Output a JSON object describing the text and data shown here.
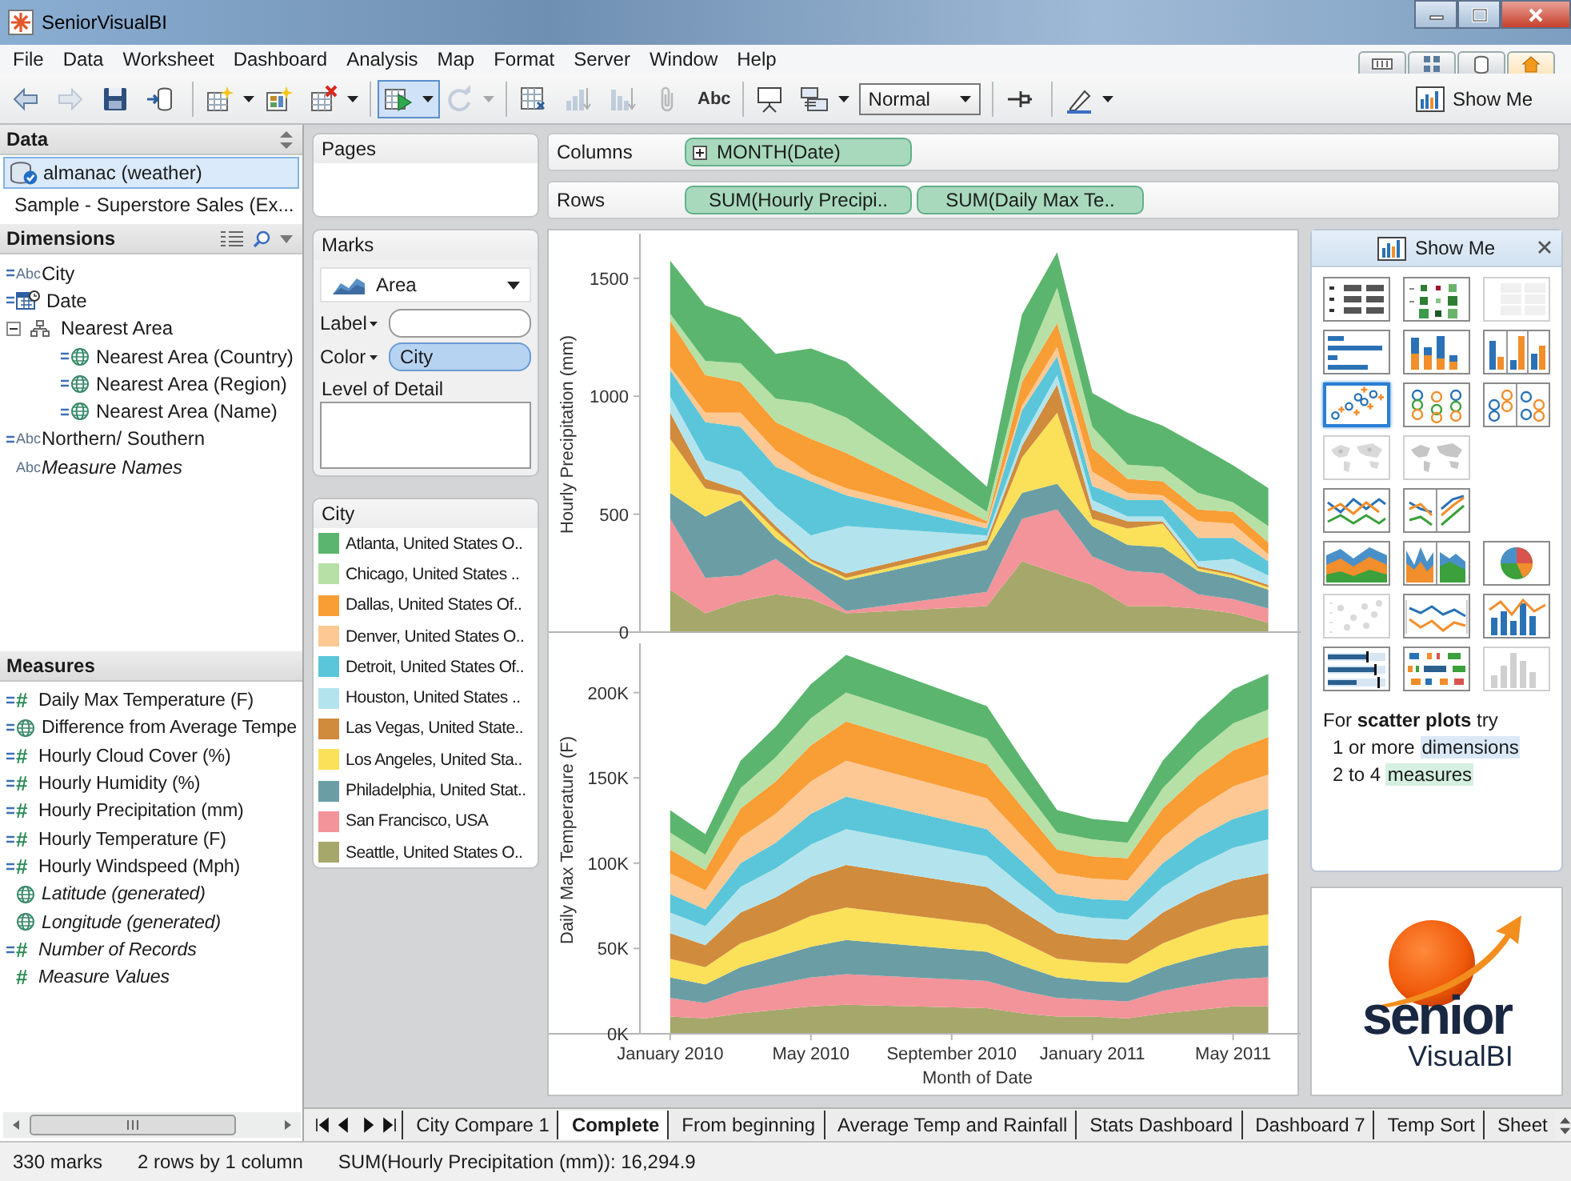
{
  "window": {
    "title": "SeniorVisualBI"
  },
  "menu": [
    "File",
    "Data",
    "Worksheet",
    "Dashboard",
    "Analysis",
    "Map",
    "Format",
    "Server",
    "Window",
    "Help"
  ],
  "view_tabs": [
    {
      "kind": "filmstrip",
      "selected": false
    },
    {
      "kind": "sorter",
      "selected": false
    },
    {
      "kind": "data",
      "selected": false
    },
    {
      "kind": "home",
      "selected": true
    }
  ],
  "toolbar": {
    "items": [
      {
        "kind": "back",
        "disabled": false,
        "pressed": false,
        "dropdown": false
      },
      {
        "kind": "forward",
        "disabled": true,
        "pressed": false,
        "dropdown": false
      },
      {
        "kind": "save",
        "disabled": false,
        "pressed": false,
        "dropdown": false
      },
      {
        "kind": "connect",
        "disabled": false,
        "pressed": false,
        "dropdown": false
      },
      {
        "kind": "separator"
      },
      {
        "kind": "new-sheet",
        "disabled": false,
        "pressed": false,
        "dropdown": true
      },
      {
        "kind": "new-dashboard",
        "disabled": false,
        "pressed": false,
        "dropdown": false
      },
      {
        "kind": "clear",
        "disabled": false,
        "pressed": false,
        "dropdown": true
      },
      {
        "kind": "separator"
      },
      {
        "kind": "auto-update",
        "disabled": false,
        "pressed": true,
        "dropdown": true
      },
      {
        "kind": "refresh",
        "disabled": true,
        "pressed": false,
        "dropdown": true
      },
      {
        "kind": "separator"
      },
      {
        "kind": "swap",
        "disabled": false,
        "pressed": false,
        "dropdown": false
      },
      {
        "kind": "sort-asc",
        "disabled": true,
        "pressed": false,
        "dropdown": false
      },
      {
        "kind": "sort-desc",
        "disabled": true,
        "pressed": false,
        "dropdown": false
      },
      {
        "kind": "attach",
        "disabled": true,
        "pressed": false,
        "dropdown": false
      },
      {
        "kind": "labels",
        "text": "Abc",
        "disabled": false,
        "pressed": false,
        "dropdown": false
      },
      {
        "kind": "separator"
      },
      {
        "kind": "presentation",
        "disabled": false,
        "pressed": false,
        "dropdown": false
      },
      {
        "kind": "fit",
        "disabled": false,
        "pressed": false,
        "dropdown": true
      },
      {
        "kind": "select",
        "value": "Normal"
      },
      {
        "kind": "separator"
      },
      {
        "kind": "pin",
        "disabled": false,
        "pressed": false,
        "dropdown": false
      },
      {
        "kind": "separator"
      },
      {
        "kind": "highlight",
        "disabled": false,
        "pressed": false,
        "dropdown": true
      }
    ],
    "show_me": {
      "label": "Show Me"
    }
  },
  "data_pane": {
    "title": "Data",
    "sources": [
      {
        "label": "almanac (weather)",
        "kind": "extract",
        "selected": true
      },
      {
        "label": "Sample - Superstore Sales (Ex...",
        "kind": "database",
        "selected": false
      }
    ]
  },
  "dimensions": {
    "title": "Dimensions",
    "fields": [
      {
        "label": "City",
        "kind": "string",
        "type_mark": "Abc",
        "marked": true,
        "generated": false
      },
      {
        "label": "Date",
        "kind": "date",
        "marked": true,
        "generated": false
      },
      {
        "label": "Nearest Area",
        "kind": "hierarchy",
        "expanded": true,
        "marked": false,
        "generated": false,
        "children": [
          {
            "label": "Nearest Area (Country)",
            "kind": "geo",
            "marked": true,
            "generated": false
          },
          {
            "label": "Nearest Area (Region)",
            "kind": "geo",
            "marked": true,
            "generated": false
          },
          {
            "label": "Nearest Area (Name)",
            "kind": "geo",
            "marked": true,
            "generated": false
          }
        ]
      },
      {
        "label": "Northern/ Southern",
        "kind": "string",
        "type_mark": "Abc",
        "marked": true,
        "generated": false
      },
      {
        "label": "Measure Names",
        "kind": "string",
        "type_mark": "Abc",
        "marked": false,
        "generated": true
      }
    ]
  },
  "measures": {
    "title": "Measures",
    "fields": [
      {
        "label": "Daily Max Temperature (F)",
        "kind": "number",
        "type_mark": "#",
        "marked": true,
        "generated": false
      },
      {
        "label": "Difference from Average Tempe",
        "kind": "geo",
        "marked": true,
        "generated": false
      },
      {
        "label": "Hourly Cloud Cover (%)",
        "kind": "number",
        "type_mark": "#",
        "marked": true,
        "generated": false
      },
      {
        "label": "Hourly Humidity (%)",
        "kind": "number",
        "type_mark": "#",
        "marked": true,
        "generated": false
      },
      {
        "label": "Hourly Precipitation (mm)",
        "kind": "number",
        "type_mark": "#",
        "marked": true,
        "generated": false
      },
      {
        "label": "Hourly Temperature (F)",
        "kind": "number",
        "type_mark": "#",
        "marked": true,
        "generated": false
      },
      {
        "label": "Hourly Windspeed (Mph)",
        "kind": "number",
        "type_mark": "#",
        "marked": true,
        "generated": false
      },
      {
        "label": "Latitude (generated)",
        "kind": "geo",
        "marked": false,
        "generated": true
      },
      {
        "label": "Longitude (generated)",
        "kind": "geo",
        "marked": false,
        "generated": true
      },
      {
        "label": "Number of Records",
        "kind": "number",
        "type_mark": "#",
        "marked": true,
        "generated": true
      },
      {
        "label": "Measure Values",
        "kind": "number",
        "type_mark": "#",
        "marked": false,
        "generated": true
      }
    ]
  },
  "pages": {
    "title": "Pages"
  },
  "marks": {
    "title": "Marks",
    "mark_type": "Area",
    "shelves": [
      {
        "kind": "field",
        "label": "Label"
      },
      {
        "kind": "field",
        "label": "Color",
        "pill": "City"
      },
      {
        "kind": "box",
        "label": "Level of Detail"
      }
    ]
  },
  "legend": {
    "title": "City",
    "items": [
      {
        "label": "Atlanta, United States O..",
        "color": "#5bb56e"
      },
      {
        "label": "Chicago, United States ..",
        "color": "#b6e0a5"
      },
      {
        "label": "Dallas, United States Of..",
        "color": "#f99d35"
      },
      {
        "label": "Denver, United States O..",
        "color": "#fdc894"
      },
      {
        "label": "Detroit, United States Of..",
        "color": "#5bc6d9"
      },
      {
        "label": "Houston, United States ..",
        "color": "#b3e4ed"
      },
      {
        "label": "Las Vegas, United State..",
        "color": "#d08b3d"
      },
      {
        "label": "Los Angeles, United Sta..",
        "color": "#fbe05a"
      },
      {
        "label": "Philadelphia, United Stat..",
        "color": "#6b9ea4"
      },
      {
        "label": "San Francisco, USA",
        "color": "#f3939a"
      },
      {
        "label": "Seattle, United States O..",
        "color": "#a5a86a"
      }
    ]
  },
  "shelves": [
    {
      "label": "Columns",
      "pills": [
        {
          "text": "MONTH(Date)",
          "expandable": true
        }
      ]
    },
    {
      "label": "Rows",
      "pills": [
        {
          "text": "SUM(Hourly Precipi..",
          "expandable": false
        },
        {
          "text": "SUM(Daily Max Te..",
          "expandable": false
        }
      ]
    }
  ],
  "charts": [
    {
      "chart_data": {
        "type": "area",
        "stacked": true,
        "ylabel": "Hourly Precipitation (mm)",
        "categories": [
          null,
          null,
          null,
          null,
          null,
          null,
          null,
          null,
          null,
          null,
          null,
          null,
          null,
          null,
          null,
          null,
          null,
          null
        ],
        "ylim": [
          0,
          1676
        ],
        "yticks": [
          0,
          500,
          1000,
          1500
        ],
        "series": [
          {
            "color": "#a5a86a",
            "values": [
              180,
              80,
              130,
              160,
              140,
              80,
              null,
              null,
              null,
              110,
              300,
              250,
              200,
              110,
              110,
              100,
              80,
              40
            ]
          },
          {
            "color": "#f3939a",
            "values": [
              300,
              150,
              110,
              150,
              60,
              10,
              null,
              null,
              null,
              60,
              180,
              270,
              120,
              150,
              140,
              60,
              60,
              60
            ]
          },
          {
            "color": "#6b9ea4",
            "values": [
              110,
              260,
              320,
              90,
              90,
              130,
              null,
              null,
              null,
              180,
              110,
              110,
              130,
              110,
              110,
              100,
              90,
              80
            ]
          },
          {
            "color": "#fbe05a",
            "values": [
              230,
              120,
              20,
              30,
              10,
              10,
              null,
              null,
              null,
              20,
              150,
              300,
              30,
              70,
              100,
              10,
              10,
              10
            ]
          },
          {
            "color": "#d08b3d",
            "values": [
              110,
              40,
              20,
              20,
              10,
              20,
              null,
              null,
              null,
              20,
              50,
              120,
              40,
              30,
              10,
              10,
              10,
              10
            ]
          },
          {
            "color": "#b3e4ed",
            "values": [
              70,
              80,
              80,
              80,
              100,
              200,
              null,
              null,
              null,
              20,
              30,
              40,
              40,
              20,
              20,
              20,
              60,
              40
            ]
          },
          {
            "color": "#5bc6d9",
            "values": [
              110,
              160,
              190,
              170,
              230,
              130,
              null,
              null,
              null,
              30,
              120,
              80,
              60,
              70,
              70,
              100,
              90,
              60
            ]
          },
          {
            "color": "#fdc894",
            "values": [
              15,
              40,
              60,
              70,
              30,
              30,
              null,
              null,
              null,
              20,
              20,
              40,
              60,
              30,
              20,
              70,
              60,
              30
            ]
          },
          {
            "color": "#f99d35",
            "values": [
              195,
              160,
              130,
              120,
              150,
              150,
              null,
              null,
              null,
              10,
              100,
              100,
              100,
              60,
              60,
              50,
              50,
              50
            ]
          },
          {
            "color": "#b6e0a5",
            "values": [
              30,
              60,
              80,
              100,
              150,
              150,
              null,
              null,
              null,
              40,
              50,
              150,
              90,
              60,
              60,
              70,
              40,
              70
            ]
          },
          {
            "color": "#5bb56e",
            "values": [
              225,
              235,
              193,
              190,
              233,
              237,
              null,
              null,
              null,
              107,
              237,
              151,
              144,
              220,
              175,
              202,
              158,
              161
            ]
          }
        ]
      }
    },
    {
      "chart_data": {
        "type": "area",
        "stacked": true,
        "ylabel": "Daily Max Temperature (F)",
        "xlabel": "Month of Date",
        "categories": [
          "January 2010",
          null,
          null,
          null,
          "May 2010",
          null,
          null,
          null,
          "September 2010",
          null,
          null,
          null,
          "January 2011",
          null,
          null,
          null,
          "May 2011",
          null
        ],
        "ylim": [
          0,
          227000
        ],
        "yticks": [
          {
            "value": 0,
            "label": "0K"
          },
          {
            "value": 50000,
            "label": "50K"
          },
          {
            "value": 100000,
            "label": "100K"
          },
          {
            "value": 150000,
            "label": "150K"
          },
          {
            "value": 200000,
            "label": "200K"
          }
        ],
        "series": [
          {
            "color": "#a5a86a",
            "values": [
              10000,
              9000,
              12000,
              14000,
              16000,
              17000,
              null,
              null,
              null,
              15000,
              12000,
              10000,
              10000,
              9000,
              12000,
              14000,
              16000,
              16000
            ]
          },
          {
            "color": "#f3939a",
            "values": [
              11000,
              9000,
              13000,
              15000,
              17000,
              18000,
              null,
              null,
              null,
              16000,
              13000,
              11000,
              10000,
              10000,
              13000,
              15000,
              16000,
              17000
            ]
          },
          {
            "color": "#6b9ea4",
            "values": [
              12000,
              11000,
              14000,
              16000,
              18000,
              20000,
              null,
              null,
              null,
              17000,
              15000,
              12000,
              11000,
              11000,
              14000,
              16000,
              18000,
              19000
            ]
          },
          {
            "color": "#fbe05a",
            "values": [
              11000,
              10000,
              14000,
              15000,
              18000,
              19000,
              null,
              null,
              null,
              16000,
              14000,
              11000,
              11000,
              11000,
              14000,
              16000,
              17000,
              18000
            ]
          },
          {
            "color": "#d08b3d",
            "values": [
              15000,
              13000,
              18000,
              20000,
              23000,
              25000,
              null,
              null,
              null,
              22000,
              18000,
              15000,
              14000,
              14000,
              18000,
              21000,
              23000,
              24000
            ]
          },
          {
            "color": "#b3e4ed",
            "values": [
              12000,
              11000,
              15000,
              17000,
              19000,
              21000,
              null,
              null,
              null,
              18000,
              15000,
              12000,
              12000,
              12000,
              15000,
              17000,
              19000,
              20000
            ]
          },
          {
            "color": "#5bc6d9",
            "values": [
              11000,
              10000,
              14000,
              15000,
              18000,
              19000,
              null,
              null,
              null,
              16000,
              14000,
              11000,
              11000,
              11000,
              14000,
              16000,
              17000,
              18000
            ]
          },
          {
            "color": "#fdc894",
            "values": [
              12000,
              11000,
              15000,
              17000,
              19000,
              21000,
              null,
              null,
              null,
              18000,
              15000,
              12000,
              12000,
              12000,
              15000,
              17000,
              19000,
              20000
            ]
          },
          {
            "color": "#f99d35",
            "values": [
              14000,
              12000,
              17000,
              19000,
              21000,
              23000,
              null,
              null,
              null,
              20000,
              17000,
              14000,
              13000,
              13000,
              17000,
              19000,
              21000,
              22000
            ]
          },
          {
            "color": "#b6e0a5",
            "values": [
              10000,
              9000,
              12000,
              14000,
              16000,
              17000,
              null,
              null,
              null,
              15000,
              12000,
              10000,
              10000,
              9000,
              12000,
              14000,
              16000,
              16000
            ]
          },
          {
            "color": "#5bb56e",
            "values": [
              13000,
              12000,
              16000,
              18000,
              20000,
              22000,
              null,
              null,
              null,
              19000,
              16000,
              13000,
              12000,
              12000,
              16000,
              18000,
              20000,
              21000
            ]
          }
        ]
      }
    }
  ],
  "show_me": {
    "title": "Show Me",
    "rows": [
      [
        {
          "kind": "text-table",
          "selected": false,
          "disabled": false
        },
        {
          "kind": "heat-map",
          "selected": false,
          "disabled": false
        },
        {
          "kind": "highlight-table",
          "selected": false,
          "disabled": true
        }
      ],
      [
        {
          "kind": "horizontal-bars",
          "selected": false,
          "disabled": false
        },
        {
          "kind": "stacked-bars",
          "selected": false,
          "disabled": false
        },
        {
          "kind": "side-by-side-bars",
          "selected": false,
          "disabled": false
        }
      ],
      [
        {
          "kind": "scatter",
          "selected": true,
          "disabled": false
        },
        {
          "kind": "circles",
          "selected": false,
          "disabled": false
        },
        {
          "kind": "side-by-side-circles",
          "selected": false,
          "disabled": false
        }
      ],
      [
        {
          "kind": "symbol-map",
          "selected": false,
          "disabled": true
        },
        {
          "kind": "filled-map",
          "selected": false,
          "disabled": true
        }
      ],
      [
        {
          "kind": "lines",
          "selected": false,
          "disabled": false
        },
        {
          "kind": "lines-discrete",
          "selected": false,
          "disabled": false
        }
      ],
      [
        {
          "kind": "area",
          "selected": false,
          "disabled": false
        },
        {
          "kind": "area-discrete",
          "selected": false,
          "disabled": false
        },
        {
          "kind": "pie",
          "selected": false,
          "disabled": false
        }
      ],
      [
        {
          "kind": "scatter-matrix",
          "selected": false,
          "disabled": true
        },
        {
          "kind": "dual-lines",
          "selected": false,
          "disabled": false
        },
        {
          "kind": "dual-combination",
          "selected": false,
          "disabled": false
        }
      ],
      [
        {
          "kind": "bullet",
          "selected": false,
          "disabled": false
        },
        {
          "kind": "gantt",
          "selected": false,
          "disabled": false
        },
        {
          "kind": "histogram",
          "selected": false,
          "disabled": true
        }
      ]
    ],
    "hint": {
      "lead": "For **scatter plots** try",
      "lines": [
        {
          "text": "1 or more ",
          "term": "dimensions",
          "kind": "dimension"
        },
        {
          "text": "2 to 4 ",
          "term": "measures",
          "kind": "measure"
        }
      ]
    }
  },
  "logo": {
    "brand": "senior",
    "subtitle": "VisualBI"
  },
  "sheet_tabs": [
    {
      "label": "City Compare 1",
      "selected": false
    },
    {
      "label": "Complete",
      "selected": true
    },
    {
      "label": "From beginning",
      "selected": false
    },
    {
      "label": "Average Temp and Rainfall",
      "selected": false
    },
    {
      "label": "Stats Dashboard",
      "selected": false
    },
    {
      "label": "Dashboard 7",
      "selected": false
    },
    {
      "label": "Temp Sort",
      "selected": false
    },
    {
      "label": "Sheet",
      "selected": false
    }
  ],
  "status_bar": [
    "330 marks",
    "2 rows by 1 column",
    "SUM(Hourly Precipitation (mm)): 16,294.9"
  ]
}
